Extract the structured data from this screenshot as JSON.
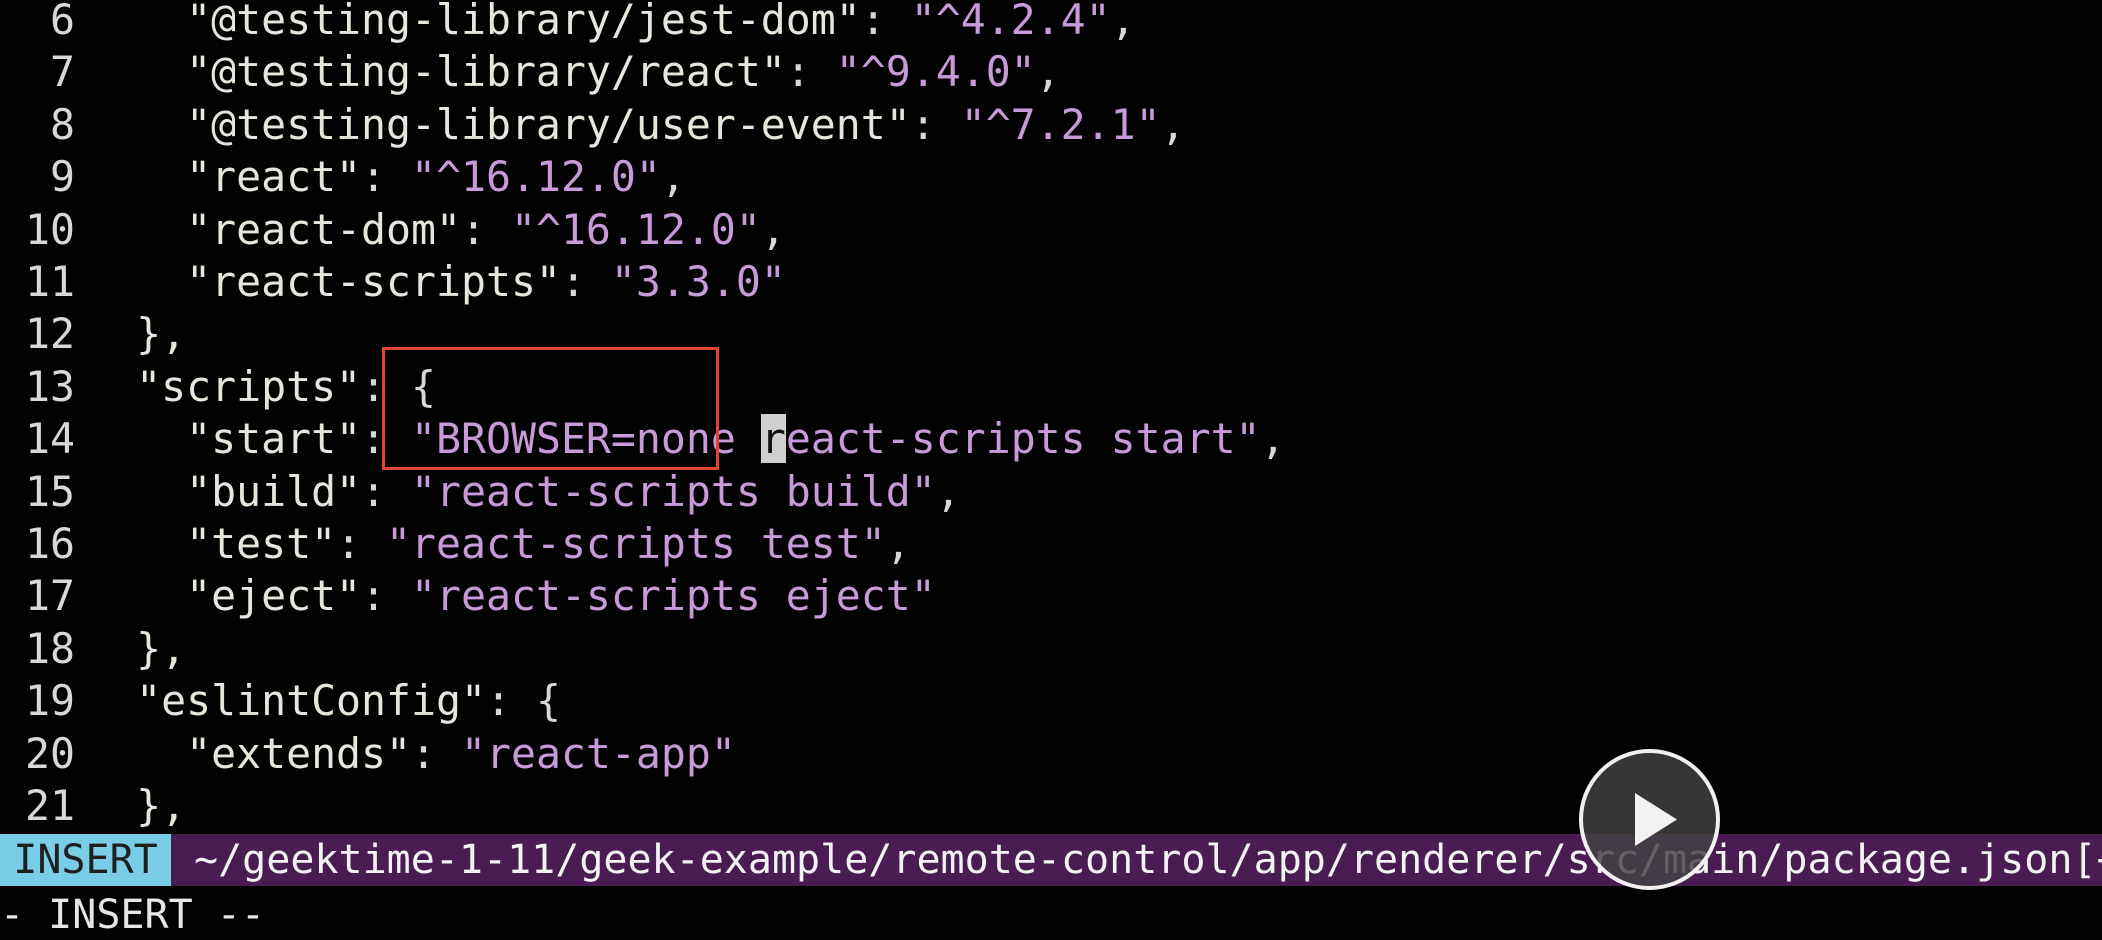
{
  "editor": {
    "lines": [
      {
        "num": "6",
        "indent": "    ",
        "key": "\"@testing-library/jest-dom\"",
        "sep": ": ",
        "value": "\"^4.2.4\"",
        "trail": ","
      },
      {
        "num": "7",
        "indent": "    ",
        "key": "\"@testing-library/react\"",
        "sep": ": ",
        "value": "\"^9.4.0\"",
        "trail": ","
      },
      {
        "num": "8",
        "indent": "    ",
        "key": "\"@testing-library/user-event\"",
        "sep": ": ",
        "value": "\"^7.2.1\"",
        "trail": ","
      },
      {
        "num": "9",
        "indent": "    ",
        "key": "\"react\"",
        "sep": ": ",
        "value": "\"^16.12.0\"",
        "trail": ","
      },
      {
        "num": "10",
        "indent": "    ",
        "key": "\"react-dom\"",
        "sep": ": ",
        "value": "\"^16.12.0\"",
        "trail": ","
      },
      {
        "num": "11",
        "indent": "    ",
        "key": "\"react-scripts\"",
        "sep": ": ",
        "value": "\"3.3.0\"",
        "trail": ""
      },
      {
        "num": "12",
        "indent": "  ",
        "key": "},",
        "sep": "",
        "value": "",
        "trail": ""
      },
      {
        "num": "13",
        "indent": "  ",
        "key": "\"scripts\"",
        "sep": ": ",
        "value": "",
        "trail": "{"
      },
      {
        "num": "14",
        "indent": "    ",
        "key": "\"start\"",
        "sep": ": ",
        "value": "\"BROWSER=none ",
        "cursor": "r",
        "value_after": "eact-scripts start\"",
        "trail": ","
      },
      {
        "num": "15",
        "indent": "    ",
        "key": "\"build\"",
        "sep": ": ",
        "value": "\"react-scripts build\"",
        "trail": ","
      },
      {
        "num": "16",
        "indent": "    ",
        "key": "\"test\"",
        "sep": ": ",
        "value": "\"react-scripts test\"",
        "trail": ","
      },
      {
        "num": "17",
        "indent": "    ",
        "key": "\"eject\"",
        "sep": ": ",
        "value": "\"react-scripts eject\"",
        "trail": ""
      },
      {
        "num": "18",
        "indent": "  ",
        "key": "},",
        "sep": "",
        "value": "",
        "trail": ""
      },
      {
        "num": "19",
        "indent": "  ",
        "key": "\"eslintConfig\"",
        "sep": ": ",
        "value": "",
        "trail": "{"
      },
      {
        "num": "20",
        "indent": "    ",
        "key": "\"extends\"",
        "sep": ": ",
        "value": "\"react-app\"",
        "trail": ""
      },
      {
        "num": "21",
        "indent": "  ",
        "key": "},",
        "sep": "",
        "value": "",
        "trail": ""
      }
    ]
  },
  "statusbar": {
    "mode": "INSERT",
    "file_path": "~/geektime-1-11/geek-example/remote-control/app/renderer/src/main/package.json[+"
  },
  "cmdline": {
    "text": "- INSERT --"
  },
  "player": {
    "play_icon": "play-icon"
  },
  "colors": {
    "background": "#020202",
    "string": "#c79bd8",
    "key": "#e6e6dc",
    "statusbar_bg": "#4a1c53",
    "mode_badge_bg": "#79cde6",
    "highlight_box": "#e2452f"
  }
}
